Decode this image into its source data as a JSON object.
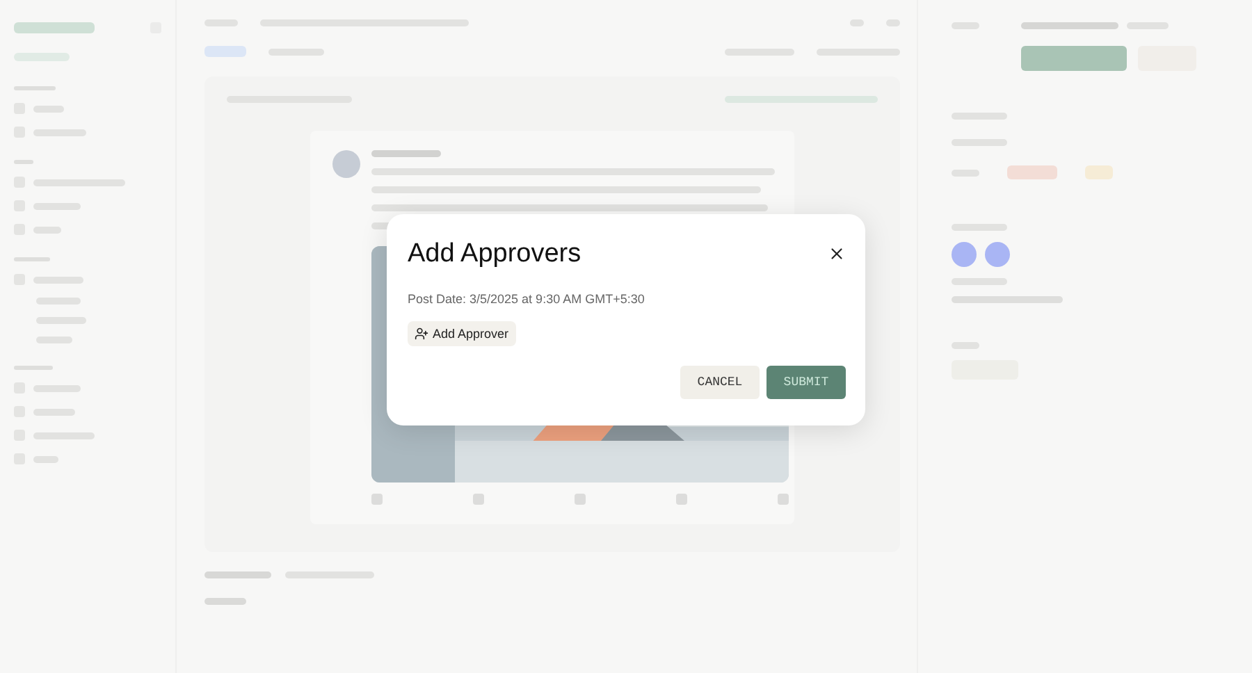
{
  "modal": {
    "title": "Add Approvers",
    "post_date": "Post Date: 3/5/2025 at 9:30 AM GMT+5:30",
    "add_approver": "Add Approver",
    "buttons": [
      {
        "label": "CANCEL",
        "kind": "secondary"
      },
      {
        "label": "SUBMIT",
        "kind": "primary"
      }
    ]
  }
}
